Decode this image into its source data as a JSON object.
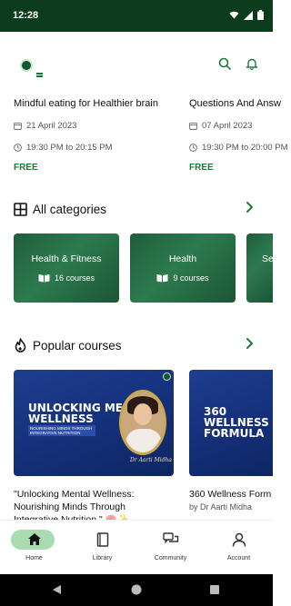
{
  "status_bar": {
    "time": "12:28",
    "icons": [
      "wifi-icon",
      "signal-icon",
      "battery-icon"
    ]
  },
  "header": {
    "icons": [
      "app-logo",
      "menu-icon",
      "search-icon",
      "bell-icon"
    ]
  },
  "events": [
    {
      "title": "Mindful eating for Healthier brain",
      "date": "21 April 2023",
      "time": "19:30 PM to 20:15 PM",
      "price": "FREE"
    },
    {
      "title": "Questions And Answ",
      "date": "07 April 2023",
      "time": "19:30 PM to 20:00 PM",
      "price": "FREE"
    }
  ],
  "categories_section": {
    "label": "All categories",
    "icon": "grid-icon"
  },
  "categories": [
    {
      "name": "Health & Fitness",
      "count": "16 courses"
    },
    {
      "name": "Health",
      "count": "9 courses"
    },
    {
      "name": "Se",
      "count": ""
    }
  ],
  "popular_section": {
    "label": "Popular courses",
    "icon": "fire-icon"
  },
  "courses": [
    {
      "thumb_title_1": "UNLOCKING MENTAL",
      "thumb_title_2": "WELLNESS",
      "thumb_sub": "NOURISHING MINDS THROUGH INTEGRATIVE NUTRITION",
      "signature": "Dr Aarti Midha",
      "title_line1": "\"Unlocking Mental Wellness:",
      "title_line2": "Nourishing Minds Through",
      "title_line3": "Integrative Nutrition.\" 🧠✨",
      "author": ""
    },
    {
      "thumb_title_1": "360 WELLNESS",
      "thumb_title_2": "FORMULA",
      "title_line1": "360 Wellness Form",
      "author": "by Dr Aarti Midha"
    }
  ],
  "bottom_nav": [
    {
      "label": "Home",
      "icon": "home-icon",
      "active": true
    },
    {
      "label": "Library",
      "icon": "book-icon",
      "active": false
    },
    {
      "label": "Community",
      "icon": "chat-icon",
      "active": false
    },
    {
      "label": "Account",
      "icon": "person-icon",
      "active": false
    }
  ],
  "colors": {
    "status_bar": "#0c3b1e",
    "accent_green": "#1b7a3a",
    "nav_pill": "#a8dcb0",
    "card_green": "#1f5e3b",
    "thumb_blue": "#1f3d8f"
  }
}
